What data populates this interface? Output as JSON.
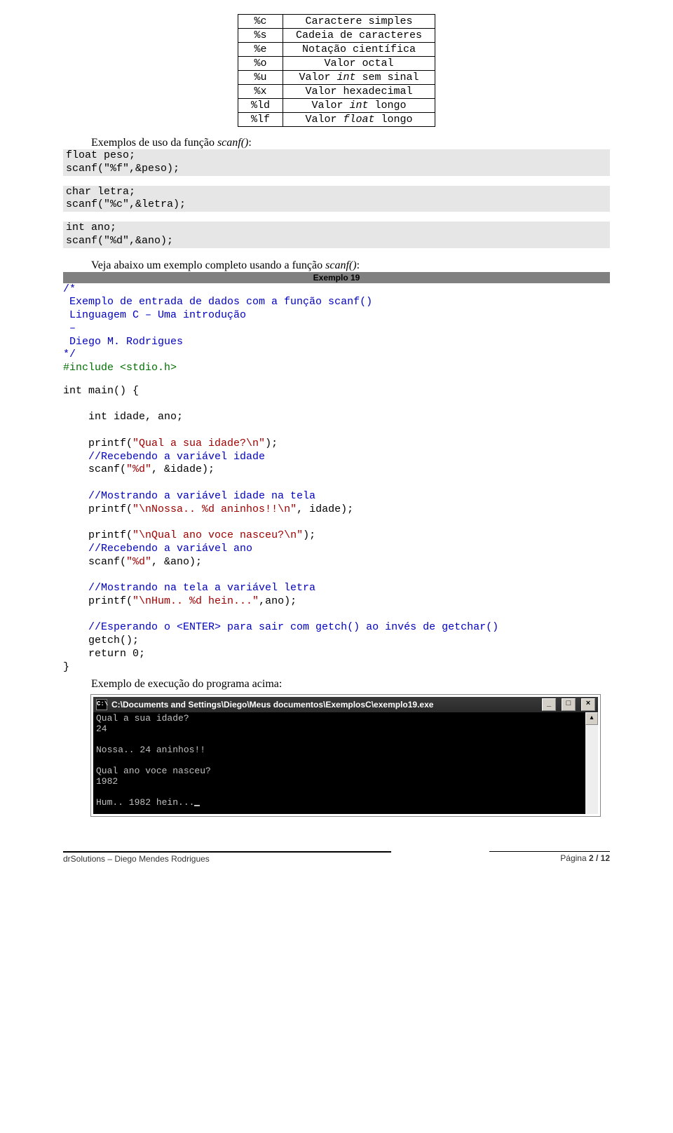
{
  "fmt_table": [
    {
      "spec": "%c",
      "desc": "Caractere simples"
    },
    {
      "spec": "%s",
      "desc": "Cadeia de caracteres"
    },
    {
      "spec": "%e",
      "desc": "Notação científica"
    },
    {
      "spec": "%o",
      "desc": "Valor octal"
    },
    {
      "spec": "%u",
      "desc": "Valor int sem sinal"
    },
    {
      "spec": "%x",
      "desc": "Valor hexadecimal"
    },
    {
      "spec": "%ld",
      "desc": "Valor int longo"
    },
    {
      "spec": "%lf",
      "desc": "Valor float longo"
    }
  ],
  "intro1_a": "Exemplos de uso da função ",
  "intro1_b": "scanf()",
  "intro1_c": ":",
  "snippet1_l1": "float peso;",
  "snippet1_l2": "scanf(\"%f\",&peso);",
  "snippet2_l1": "char letra;",
  "snippet2_l2": "scanf(\"%c\",&letra);",
  "snippet3_l1": "int ano;",
  "snippet3_l2": "scanf(\"%d\",&ano);",
  "intro2_a": "Veja abaixo um exemplo completo usando a função ",
  "intro2_b": "scanf()",
  "intro2_c": ":",
  "example_bar": "Exemplo 19",
  "comment_block": "/*\n Exemplo de entrada de dados com a função scanf()\n Linguagem C – Uma introdução\n –\n Diego M. Rodrigues\n*/",
  "include_line": "#include <stdio.h>",
  "main_open": "int main() {",
  "decl": "    int idade, ano;",
  "p1_a": "    printf(",
  "p1_s": "\"Qual a sua idade?\\n\"",
  "p1_b": ");",
  "c1": "    //Recebendo a variável idade",
  "sc1_a": "    scanf(",
  "sc1_s": "\"%d\"",
  "sc1_b": ", &idade);",
  "c2": "    //Mostrando a variável idade na tela",
  "p2_a": "    printf(",
  "p2_s": "\"\\nNossa.. %d aninhos!!\\n\"",
  "p2_b": ", idade);",
  "p3_a": "    printf(",
  "p3_s": "\"\\nQual ano voce nasceu?\\n\"",
  "p3_b": ");",
  "c3": "    //Recebendo a variável ano",
  "sc2_a": "    scanf(",
  "sc2_s": "\"%d\"",
  "sc2_b": ", &ano);",
  "c4": "    //Mostrando na tela a variável letra",
  "p4_a": "    printf(",
  "p4_s": "\"\\nHum.. %d hein...\"",
  "p4_b": ",ano);",
  "c5": "    //Esperando o <ENTER> para sair com getch() ao invés de getchar()",
  "getch": "    getch();",
  "ret": "    return 0;",
  "close": "}",
  "exec_caption": "Exemplo de execução do programa acima:",
  "term": {
    "title": "C:\\Documents and Settings\\Diego\\Meus documentos\\ExemplosC\\exemplo19.exe",
    "l1": "Qual a sua idade?",
    "l2": "24",
    "l3": "",
    "l4": "Nossa.. 24 aninhos!!",
    "l5": "",
    "l6": "Qual ano voce nasceu?",
    "l7": "1982",
    "l8": "",
    "l9_a": "Hum.. 1982 hein..."
  },
  "footer_left": "drSolutions – Diego Mendes Rodrigues",
  "footer_right_a": "Página ",
  "footer_right_b": "2 / 12"
}
